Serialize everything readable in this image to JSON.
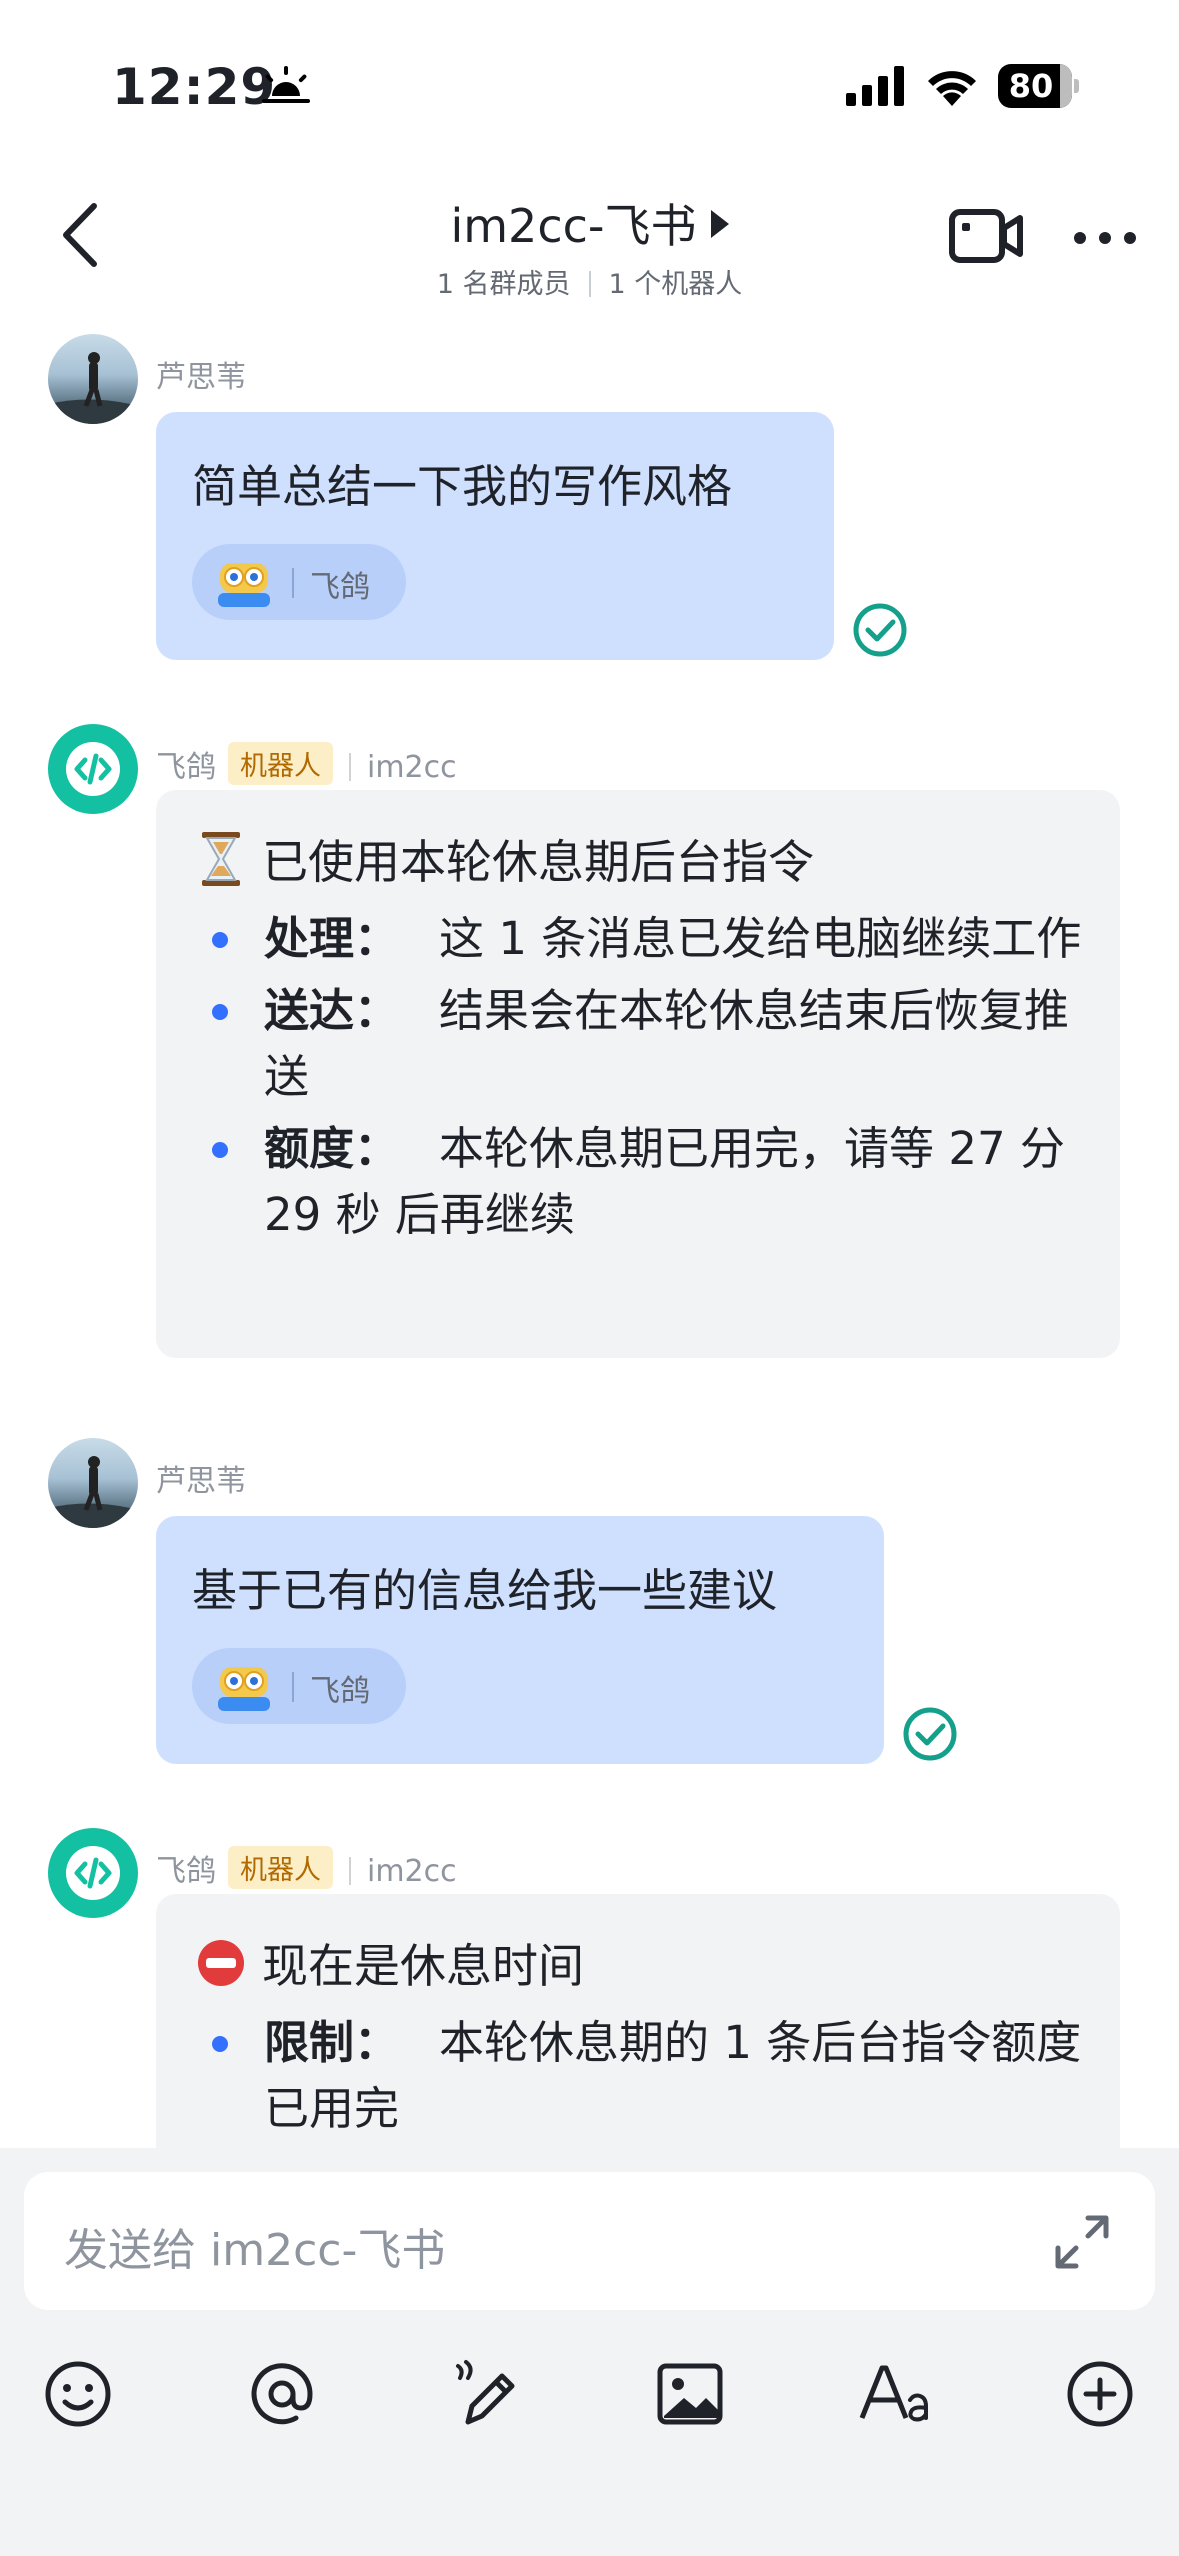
{
  "status_bar": {
    "time": "12:29",
    "battery": "80",
    "battery_level_percent": 80
  },
  "header": {
    "title": "im2cc-飞书",
    "members": "1 名群成员",
    "bots": "1 个机器人"
  },
  "messages": [
    {
      "sender": "芦思苇",
      "text": "简单总结一下我的写作风格",
      "reaction": {
        "emoji_icon": "robot-emoji-icon",
        "name": "飞鸽"
      }
    },
    {
      "sender": "飞鸽",
      "badge": "机器人",
      "source": "im2cc",
      "title": "已使用本轮休息期后台指令",
      "title_icon": "hourglass-icon",
      "items": [
        {
          "key": "处理：",
          "value": "这 1 条消息已发给电脑继续工作"
        },
        {
          "key": "送达：",
          "value": "结果会在本轮休息结束后恢复推送"
        },
        {
          "key": "额度：",
          "value": "本轮休息期已用完，请等 27 分 29 秒 后再继续"
        }
      ]
    },
    {
      "sender": "芦思苇",
      "text": "基于已有的信息给我一些建议",
      "reaction": {
        "emoji_icon": "robot-emoji-icon",
        "name": "飞鸽"
      }
    },
    {
      "sender": "飞鸽",
      "badge": "机器人",
      "source": "im2cc",
      "title": "现在是休息时间",
      "title_icon": "no-entry-icon",
      "items": [
        {
          "key": "限制：",
          "value": "本轮休息期的 1 条后台指令额度已用完"
        }
      ]
    }
  ],
  "composer": {
    "placeholder": "发送给 im2cc-飞书"
  },
  "toolbar": [
    "emoji-icon",
    "mention-icon",
    "draw-icon",
    "image-icon",
    "text-format-icon",
    "add-icon"
  ],
  "colors": {
    "user_bubble": "#cfe0ff",
    "bot_bubble": "#f2f3f5",
    "accent": "#3370ff",
    "bot_avatar": "#14c0a2",
    "read": "#14a08b"
  }
}
